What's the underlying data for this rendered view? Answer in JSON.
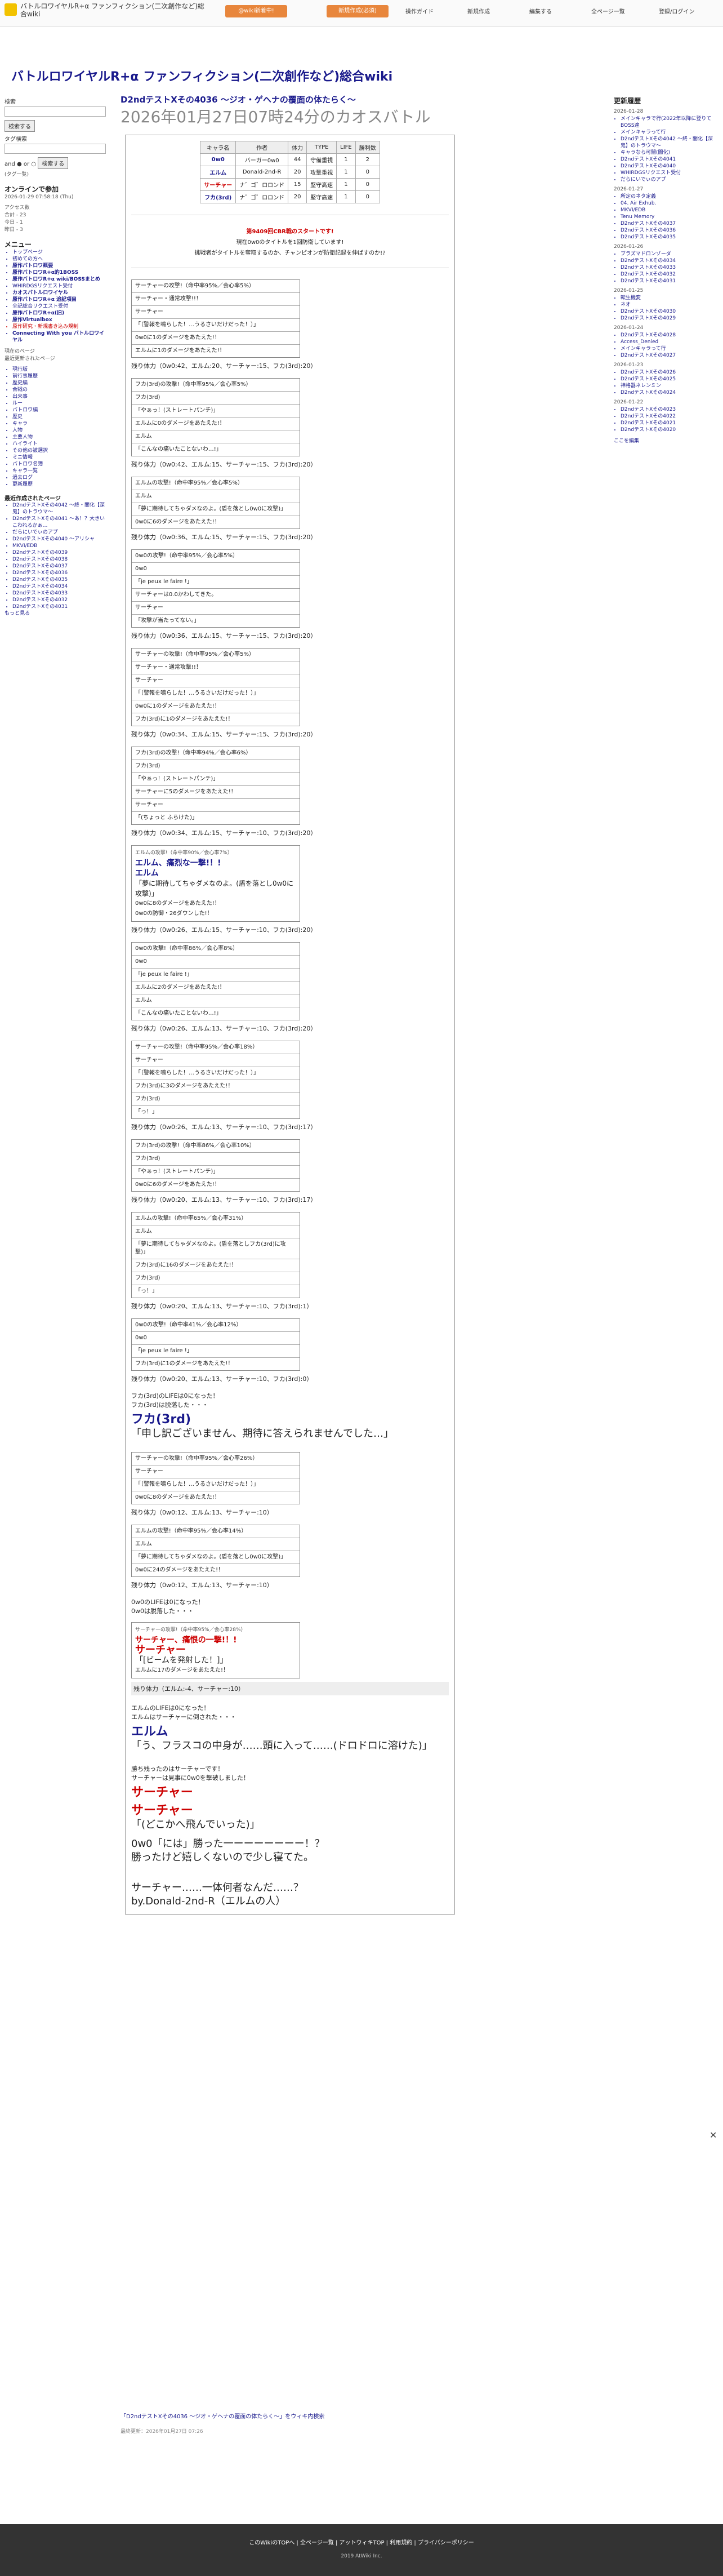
{
  "header": {
    "site_title": "バトルロワイヤルR+α ファンフィクション(二次創作など)総合wiki",
    "ad1": "@wiki新着中!",
    "ad2": "新規作成(必須)",
    "nav": [
      "操作ガイド",
      "新規作成",
      "編集する",
      "全ページ一覧",
      "登録/ログイン"
    ]
  },
  "page_heading": "バトルロワイヤルR+α ファンフィクション(二次創作など)総合wiki",
  "left": {
    "search_label": "検索",
    "search_btn": "検索する",
    "tag_label": "タグ検索",
    "and": "and",
    "or": "or",
    "tag_btn": "検索する",
    "tag_list": "(タグ一覧)",
    "online_label": "オンラインで参加",
    "date": "2026-01-29 07:58:18 (Thu)",
    "access_label": "アクセス数",
    "access": [
      "合計 - 23",
      "今日 - 1",
      "昨日 - 3"
    ],
    "menu_title": "メニュー",
    "menu": [
      {
        "t": "トップページ",
        "c": ""
      },
      {
        "t": "初めての方へ",
        "c": ""
      },
      {
        "t": "原作バトロワ概要",
        "c": "b"
      },
      {
        "t": "原作バトロワR+α的1BOSS",
        "c": "b"
      },
      {
        "t": "原作バトロワR+α wiki/BOSSまとめ",
        "c": "b"
      },
      {
        "t": "WHIRDGSリクエスト受付",
        "c": ""
      },
      {
        "t": "カオスバトルロワイヤル",
        "c": "b"
      },
      {
        "t": "原作バトロワR+α 追記項目",
        "c": "b"
      },
      {
        "t": "全記総合リクエスト受付",
        "c": ""
      },
      {
        "t": "原作バトロワR+α(旧)",
        "c": "b"
      },
      {
        "t": "原作Virtualbox",
        "c": "b"
      },
      {
        "t": "原作研究・新規書き込み規制",
        "c": "r"
      },
      {
        "t": "Connecting With you バトルロワイヤル",
        "c": "b"
      }
    ],
    "sec2": [
      "現在のページ",
      "最近更新されたページ"
    ],
    "sub": [
      "現行版",
      "前行事履歴",
      "歴史編",
      "合戦の",
      "出来事",
      "ルー",
      "バトロワ編",
      "歴史",
      "キャラ",
      "人物",
      "主要人物",
      "ハイライト",
      "その他の被選択",
      "ミニ情報",
      "バトロワ名簿",
      "キャラ一覧",
      "過去ログ",
      "更新履歴"
    ],
    "recent_title": "最近作成されたページ",
    "recent": [
      "D2ndテストXその4042 〜終・闇化【深鬼】のトラウマ〜",
      "D2ndテストXその4041 〜あ！？大きいこわれるかぁ…",
      "だらにいでぃのアプ",
      "D2ndテストXその4040 〜アリシャ",
      "MKVI/EDB",
      "D2ndテストXその4039",
      "D2ndテストXその4038",
      "D2ndテストXその4037",
      "D2ndテストXその4036",
      "D2ndテストXその4035",
      "D2ndテストXその4034",
      "D2ndテストXその4033",
      "D2ndテストXその4032",
      "D2ndテストXその4031"
    ],
    "more": "もっと見る"
  },
  "right": {
    "title": "更新履歴",
    "days": [
      {
        "d": "2026-01-28",
        "i": [
          "メインキャラで行(2022年以降に登りてBOSS達",
          "メインキャラって行",
          "D2ndテストXその4042 〜終・闇化【深鬼】のトラウマ〜",
          "キャラなら可闇(闇化)",
          "D2ndテストXその4041",
          "D2ndテストXその4040",
          "WHIRDGSリクエスト受付",
          "だらにいでぃのアプ"
        ]
      },
      {
        "d": "2026-01-27",
        "i": [
          "所定のネタ定義",
          "04. Air Exhub.",
          "MKVI/EDB",
          "Tenu Memory",
          "D2ndテストXその4037",
          "D2ndテストXその4036",
          "D2ndテストXその4035"
        ]
      },
      {
        "d": "2026-01-26",
        "i": [
          "ブラズマドロンゾーダ",
          "D2ndテストXその4034",
          "D2ndテストXその4033",
          "D2ndテストXその4032",
          "D2ndテストXその4031"
        ]
      },
      {
        "d": "2026-01-25",
        "i": [
          "転生機変",
          "ネオ",
          "D2ndテストXその4030",
          "D2ndテストXその4029"
        ]
      },
      {
        "d": "2026-01-24",
        "i": [
          "D2ndテストXその4028",
          "Access_Denied",
          "メインキャラって行",
          "D2ndテストXその4027"
        ]
      },
      {
        "d": "2026-01-23",
        "i": [
          "D2ndテストXその4026",
          "D2ndテストXその4025",
          "神格器ネレンミン",
          "D2ndテストXその4024"
        ]
      },
      {
        "d": "2026-01-22",
        "i": [
          "D2ndテストXその4023",
          "D2ndテストXその4022",
          "D2ndテストXその4021",
          "D2ndテストXその4020"
        ]
      }
    ],
    "more": "ここを編集"
  },
  "article": {
    "title1": "D2ndテストXその4036 〜ジオ・ゲヘナの覆面の体たらく〜",
    "title2": "2026年01月27日07時24分のカオスバトル",
    "stat_head": [
      "キャラ名",
      "作者",
      "体力",
      "TYPE",
      "LIFE",
      "勝利数"
    ],
    "stats": [
      [
        "0w0",
        "バーガー0w0",
        "44",
        "守備重視",
        "1",
        "2"
      ],
      [
        "エルム",
        "Donald-2nd-R",
        "20",
        "攻撃重視",
        "1",
        "0"
      ],
      [
        "サーチャー",
        "ナ゛ゴ゛ロロンド",
        "15",
        "堅守高速",
        "1",
        "0"
      ],
      [
        "フカ(3rd)",
        "ナ゛ゴ゛ロロンド",
        "20",
        "堅守高速",
        "1",
        "0"
      ]
    ],
    "intro": [
      "第9409回CBR戦のスタートです!",
      "現在0w0のタイトルを1回防衛しています!",
      "挑戦者がタイトルを奪取するのか、チャンピオンが防衛記録を伸ばすのか!?"
    ],
    "turns": [
      {
        "rows": [
          "サーチャーの攻撃!（命中率95%／会心率5%）",
          "サーチャー・通常攻撃!!！",
          "サーチャー",
          "「（警報を鳴らした！…うるさいだけだった！）」",
          "0w0に1のダメージをあたえた!！",
          "エルムに1のダメージをあたえた!！"
        ],
        "rem": "残り体力（0w0:42、エルム:20、サーチャー:15、フカ(3rd):20）"
      },
      {
        "rows": [
          "フカ(3rd)の攻撃!（命中率95%／会心率5%）",
          "フカ(3rd)",
          "「やぁっ！(ストレートパンチ)」",
          "エルムに0のダメージをあたえた!！",
          "エルム",
          "「こんなの痛いたことないわ…!」"
        ],
        "rem": "残り体力（0w0:42、エルム:15、サーチャー:15、フカ(3rd):20）"
      },
      {
        "rows": [
          "エルムの攻撃!（命中率95%／会心率5%）",
          "エルム",
          "「夢に期待してちゃダメなのよ。(盾を落とし0w0に攻撃)」",
          "0w0に6のダメージをあたえた!！"
        ],
        "rem": "残り体力（0w0:36、エルム:15、サーチャー:15、フカ(3rd):20）"
      },
      {
        "rows": [
          "0w0の攻撃!（命中率95%／会心率5%）",
          "0w0",
          "「je peux le faire !」",
          "サーチャーは0.0かわしてきた。",
          "サーチャー",
          "「攻撃が当たってない。」"
        ],
        "rem": "残り体力（0w0:36、エルム:15、サーチャー:15、フカ(3rd):20）"
      },
      {
        "rows": [
          "サーチャーの攻撃!（命中率95%／会心率5%）",
          "サーチャー・通常攻撃!!！",
          "サーチャー",
          "「（警報を鳴らした！…うるさいだけだった！）」",
          "0w0に1のダメージをあたえた!！",
          "フカ(3rd)に1のダメージをあたえた!！"
        ],
        "rem": "残り体力（0w0:34、エルム:15、サーチャー:15、フカ(3rd):20）"
      },
      {
        "rows": [
          "フカ(3rd)の攻撃!（命中率94%／会心率6%）",
          "フカ(3rd)",
          "「やぁっ！(ストレートパンチ)」",
          "サーチャーに5のダメージをあたえた!！",
          "サーチャー",
          "「(ちょっと ふらけた)」"
        ],
        "rem": "残り体力（0w0:34、エルム:15、サーチャー:10、フカ(3rd):20）"
      }
    ],
    "special": {
      "line1": "エルムの攻撃!（命中率90%／会心率7%）",
      "line2": "エルム、痛烈な一撃!！!",
      "line3": "エルム",
      "line4": "「夢に期待してちゃダメなのよ。(盾を落とし0w0に攻撃)」",
      "line5": "0w0に8のダメージをあたえた!！",
      "line6": "0w0の防御・26ダウンした!！"
    },
    "rem_after": "残り体力（0w0:26、エルム:15、サーチャー:10、フカ(3rd):20）",
    "turns2": [
      {
        "rows": [
          "0w0の攻撃!（命中率86%／会心率8%）",
          "0w0",
          "「je peux le faire !」",
          "エルムに2のダメージをあたえた!！",
          "エルム",
          "「こんなの痛いたことないわ…!」"
        ],
        "rem": "残り体力（0w0:26、エルム:13、サーチャー:10、フカ(3rd):20）"
      },
      {
        "rows": [
          "サーチャーの攻撃!（命中率95%／会心率18%）",
          "サーチャー",
          "「（警報を鳴らした！…うるさいだけだった！）」",
          "フカ(3rd)に3のダメージをあたえた!！",
          "フカ(3rd)",
          "「っ！」"
        ],
        "rem": "残り体力（0w0:26、エルム:13、サーチャー:10、フカ(3rd):17）"
      },
      {
        "rows": [
          "フカ(3rd)の攻撃!（命中率86%／会心率10%）",
          "フカ(3rd)",
          "「やぁっ！(ストレートパンチ)」",
          "0w0に6のダメージをあたえた!！"
        ],
        "rem": "残り体力（0w0:20、エルム:13、サーチャー:10、フカ(3rd):17）"
      },
      {
        "rows": [
          "エルムの攻撃!（命中率65%／会心率31%）",
          "エルム",
          "「夢に期待してちゃダメなのよ。(盾を落としフカ(3rd)に攻撃)」",
          "フカ(3rd)に16のダメージをあたえた!！",
          "フカ(3rd)",
          "「っ！」"
        ],
        "rem": "残り体力（0w0:20、エルム:13、サーチャー:10、フカ(3rd):1）"
      },
      {
        "rows": [
          "0w0の攻撃!（命中率41%／会心率12%）",
          "0w0",
          "「je peux le faire !」",
          "フカ(3rd)に1のダメージをあたえた!！"
        ],
        "rem": "残り体力（0w0:20、エルム:13、サーチャー:10、フカ(3rd):0）"
      }
    ],
    "defeat1": [
      "フカ(3rd)のLIFEは0になった！",
      "フカ(3rd)は脱落した・・・"
    ],
    "defeat_big": "フカ(3rd)",
    "defeat_quote": "「申し訳ございません、期待に答えられませんでした…」",
    "turns3": [
      {
        "rows": [
          "サーチャーの攻撃!（命中率95%／会心率26%）",
          "サーチャー",
          "「（警報を鳴らした！…うるさいだけだった！）」",
          "0w0に8のダメージをあたえた!！"
        ],
        "rem": "残り体力（0w0:12、エルム:13、サーチャー:10）"
      },
      {
        "rows": [
          "エルムの攻撃!（命中率95%／会心率14%）",
          "エルム",
          "「夢に期待してちゃダメなのよ。(盾を落とし0w0に攻撃)」",
          "0w0に24のダメージをあたえた!！"
        ],
        "rem": "残り体力（0w0:12、エルム:13、サーチャー:10）"
      }
    ],
    "defeat2": [
      "0w0のLIFEは0になった！",
      "0w0は脱落した・・・"
    ],
    "final_turn": {
      "rows": [
        "サーチャーの攻撃!（命中率95%／会心率28%）",
        "サーチャー、痛恨の一撃!！!",
        "サーチャー",
        "「[ビームを発射した！]」",
        "エルムに17のダメージをあたえた!！"
      ],
      "rem": "残り体力（エルム:-4、サーチャー:10）"
    },
    "defeat3": [
      "エルムのLIFEは0になった！",
      "エルムはサーチャーに倒された・・・"
    ],
    "elm_big": "エルム",
    "elm_quote": "「う、フラスコの中身が……頭に入って……(ドロドロに溶けた)」",
    "win": [
      "勝ち残ったのはサーチャーです！",
      "サーチャーは見事に0w0を撃破しました！"
    ],
    "win_big1": "サーチャー",
    "win_big2": "サーチャー",
    "win_quote": "「(どこかへ飛んでいった)」",
    "ending1": "0w0「には」勝った一ーーーーーーー！？",
    "ending2": "勝ったけど嬉しくないので少し寝てた。",
    "ending3": "サーチャー……一体何者なんだ……？",
    "ending4": "by.Donald-2nd-R（エルムの人）"
  },
  "wiki_link": "「D2ndテストXその4036 〜ジオ・ゲヘナの覆面の体たらく〜」をウィキ内検索",
  "updated": "最終更新：2026年01月27日 07:26",
  "footer": {
    "links": "このWikiのTOPへ | 全ページ一覧 | アットウィキTOP | 利用規約 | プライバシーポリシー",
    "copy": "2019 AtWiki Inc."
  }
}
